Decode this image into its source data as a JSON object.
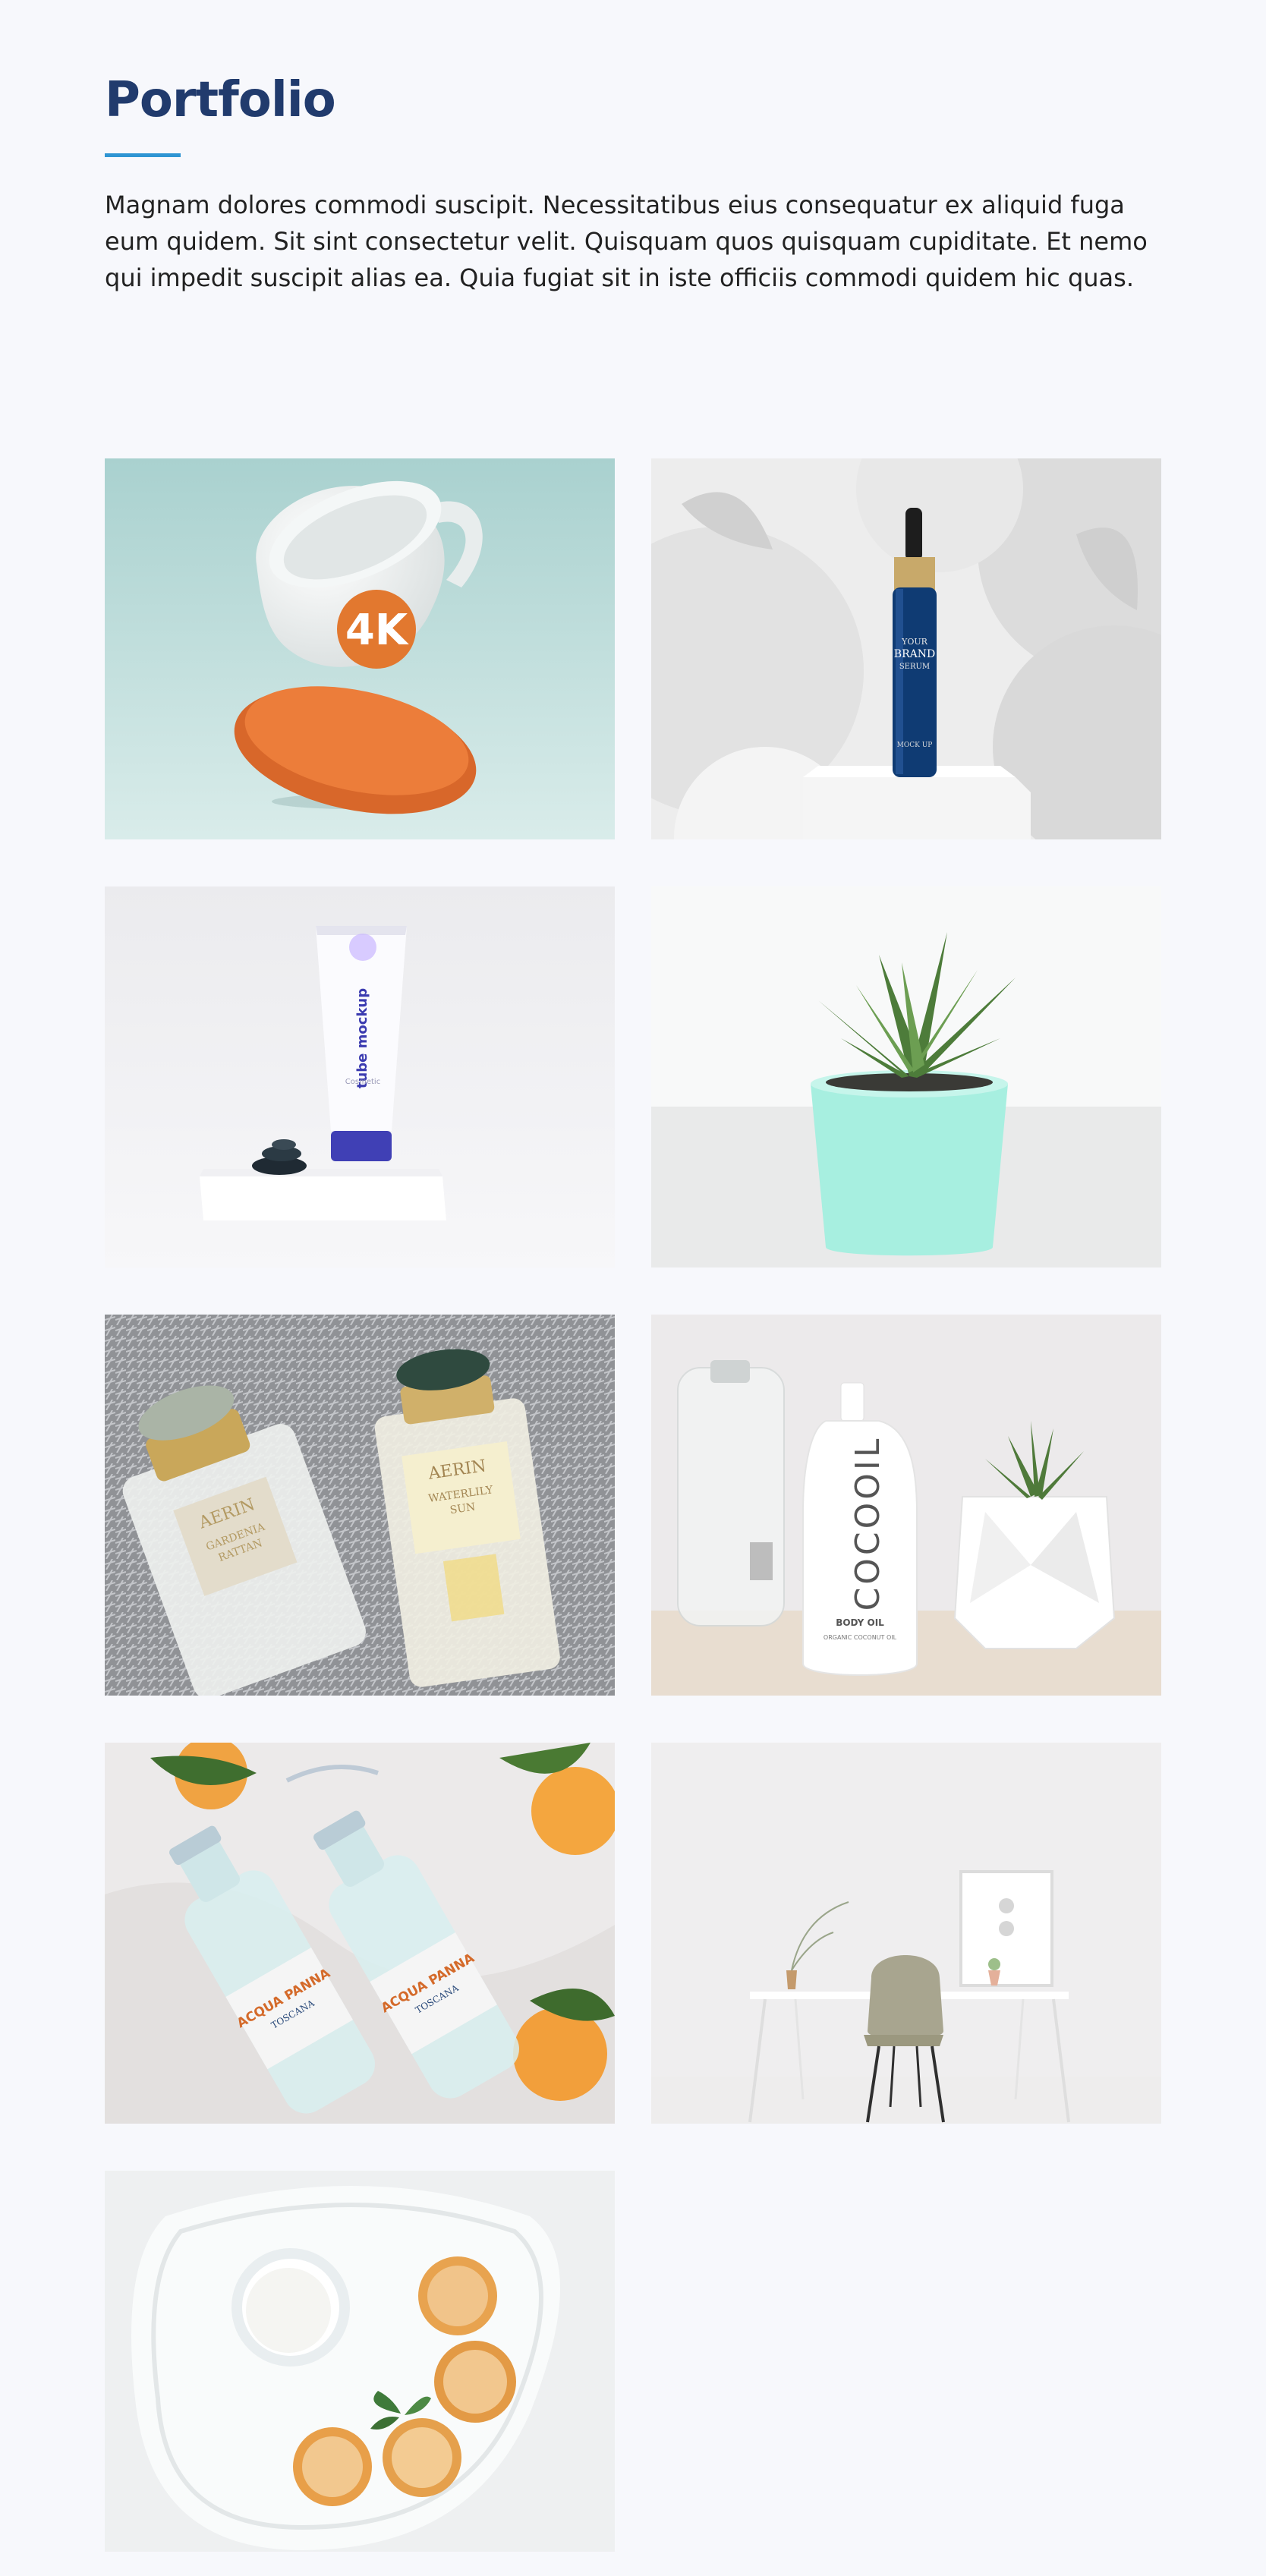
{
  "section": {
    "title": "Portfolio",
    "description": "Magnam dolores commodi suscipit. Necessitatibus eius consequatur ex aliquid fuga eum quidem. Sit sint consectetur velit. Quisquam quos quisquam cupiditate. Et nemo qui impedit suscipit alias ea. Quia fugiat sit in iste officiis commodi quidem hic quas."
  },
  "colors": {
    "background": "#f7f8fc",
    "title": "#213b6d",
    "accent_bar": "#2f95d3",
    "body_text": "#222222"
  },
  "portfolio_items": [
    {
      "name": "cup-mockup",
      "labels": {
        "logo": "4K"
      }
    },
    {
      "name": "serum-bottle-mockup",
      "labels": {
        "line1": "YOUR",
        "line2": "BRAND",
        "line3": "SERUM",
        "line4": "MOCK UP"
      }
    },
    {
      "name": "tube-mockup",
      "labels": {
        "main": "tube mockup",
        "sub": "Cosmetic"
      }
    },
    {
      "name": "succulent-plant",
      "labels": {}
    },
    {
      "name": "perfume-bottles",
      "labels": {
        "brand1": "AERIN",
        "scent1": "GARDENIA",
        "scent1b": "RATTAN",
        "brand2": "AERIN",
        "scent2": "WATERLILY",
        "scent2b": "SUN"
      }
    },
    {
      "name": "body-oil-bottle",
      "labels": {
        "brand": "COCOOIL",
        "product": "BODY OIL",
        "desc": "ORGANIC COCONUT OIL"
      }
    },
    {
      "name": "water-bottles",
      "labels": {
        "brand": "ACQUA PANNA",
        "region": "TOSCANA"
      }
    },
    {
      "name": "desk-chair",
      "labels": {}
    },
    {
      "name": "cookies-plate",
      "labels": {}
    }
  ]
}
